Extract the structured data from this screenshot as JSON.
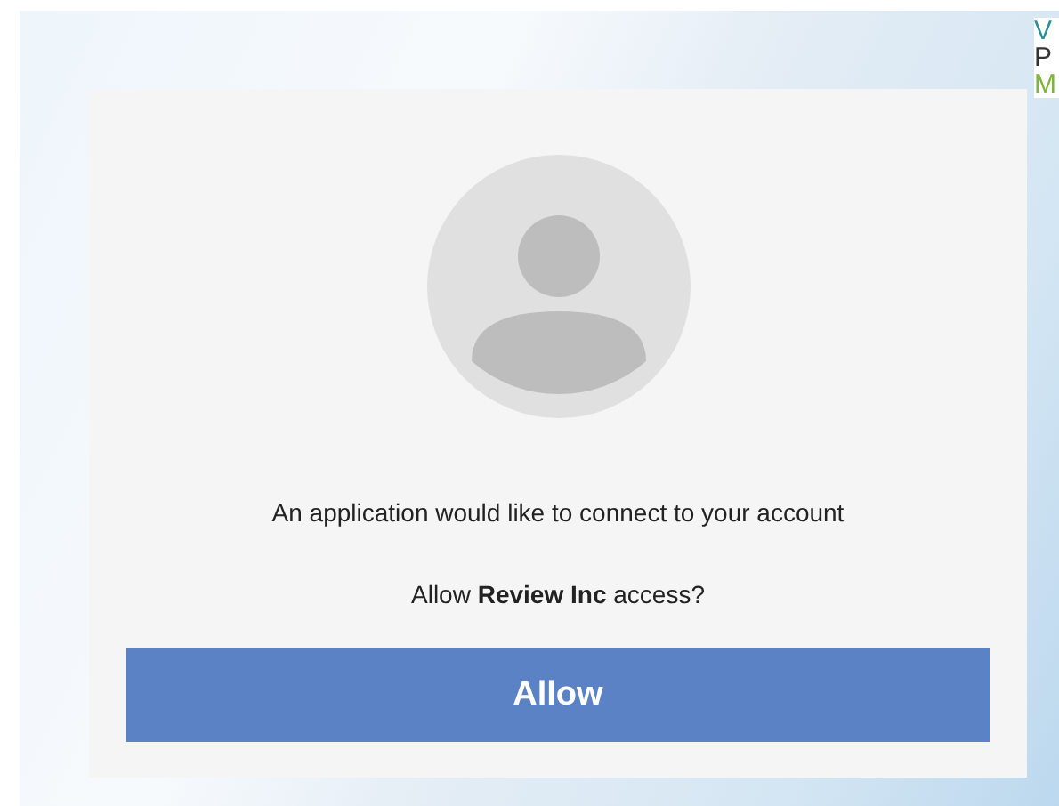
{
  "logo": {
    "letters": [
      {
        "text": "V",
        "color": "#2a8f9a"
      },
      {
        "text": "P",
        "color": "#333333"
      },
      {
        "text": "M",
        "color": "#7cb53a"
      }
    ]
  },
  "dialog": {
    "message": "An application would like to connect to your account",
    "question": "Allow **Review Inc** access?",
    "button": "Allow"
  }
}
